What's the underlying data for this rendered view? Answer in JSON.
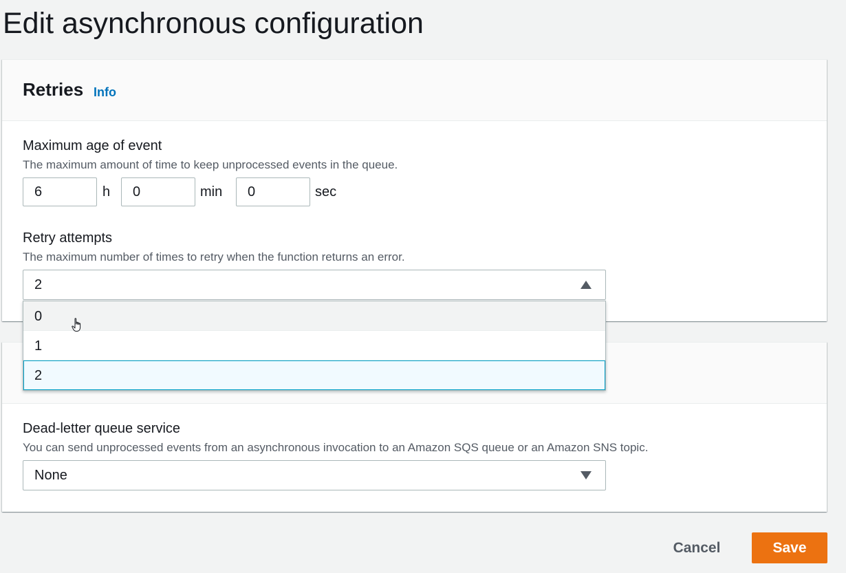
{
  "page": {
    "title": "Edit asynchronous configuration"
  },
  "retries": {
    "title": "Retries",
    "info_label": "Info",
    "max_age": {
      "label": "Maximum age of event",
      "description": "The maximum amount of time to keep unprocessed events in the queue.",
      "hours_value": "6",
      "hours_unit": "h",
      "minutes_value": "0",
      "minutes_unit": "min",
      "seconds_value": "0",
      "seconds_unit": "sec"
    },
    "retry_attempts": {
      "label": "Retry attempts",
      "description": "The maximum number of times to retry when the function returns an error.",
      "selected_value": "2",
      "options": [
        "0",
        "1",
        "2"
      ],
      "hovered_option": "0"
    }
  },
  "dlq": {
    "label": "Dead-letter queue service",
    "description": "You can send unprocessed events from an asynchronous invocation to an Amazon SQS queue or an Amazon SNS topic.",
    "selected_value": "None"
  },
  "actions": {
    "cancel_label": "Cancel",
    "save_label": "Save"
  },
  "colors": {
    "save_button": "#ec7211",
    "info_link": "#0073bb",
    "selected_option_bg": "#f1faff",
    "selected_option_border": "#00a1c9"
  },
  "icons": {
    "retry_select_caret": "caret-up-icon",
    "dlq_select_caret": "caret-down-icon",
    "cursor": "hand-pointer-icon"
  }
}
